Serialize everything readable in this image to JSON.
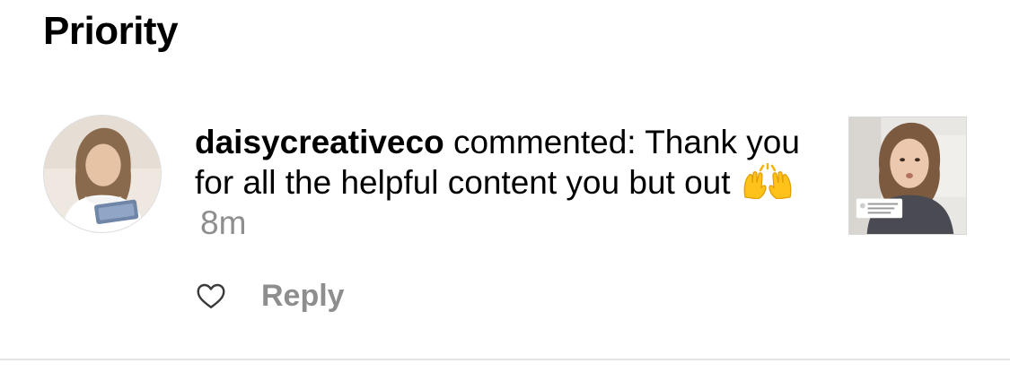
{
  "section": {
    "title": "Priority"
  },
  "notification": {
    "username": "daisycreativeco",
    "action": "commented:",
    "comment": "Thank you for all the helpful content you but out",
    "emoji": "raising-hands",
    "time": "8m",
    "avatar_icon": "user-avatar-photo",
    "thumbnail_icon": "post-thumbnail-photo"
  },
  "actions": {
    "like_icon": "heart-outline-icon",
    "reply_label": "Reply"
  },
  "colors": {
    "text": "#000000",
    "secondary": "#8e8e8e",
    "divider": "#e4e4e4"
  }
}
